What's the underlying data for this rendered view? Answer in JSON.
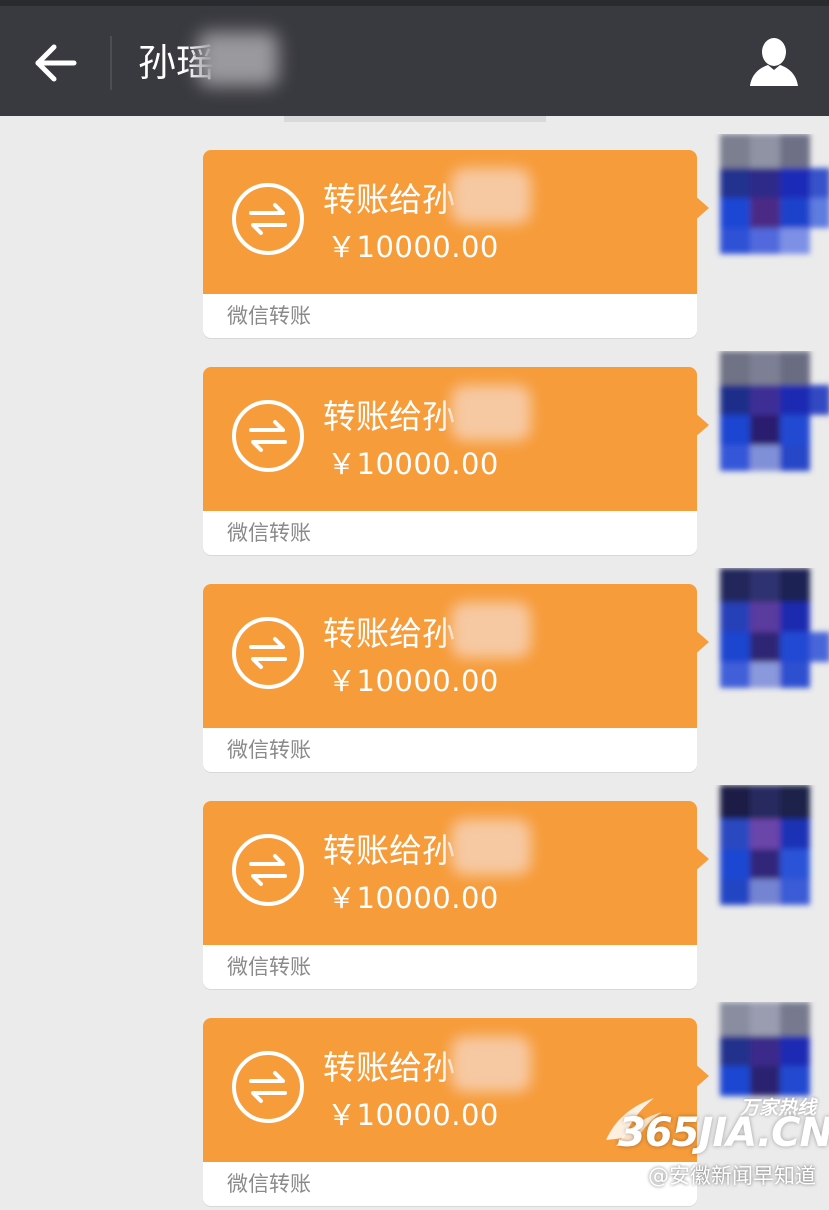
{
  "header": {
    "title": "孙瑶",
    "back_icon": "arrow-left-icon",
    "profile_icon": "person-icon",
    "background": "#393a3f"
  },
  "colors": {
    "card_orange": "#f79c3a",
    "page_bg": "#ebebeb",
    "footer_text": "#8a8a8a"
  },
  "messages": [
    {
      "title": "转账给孙",
      "amount": "￥10000.00",
      "footer": "微信转账",
      "icon": "transfer-icon"
    },
    {
      "title": "转账给孙",
      "amount": "￥10000.00",
      "footer": "微信转账",
      "icon": "transfer-icon"
    },
    {
      "title": "转账给孙",
      "amount": "￥10000.00",
      "footer": "微信转账",
      "icon": "transfer-icon"
    },
    {
      "title": "转账给孙",
      "amount": "￥10000.00",
      "footer": "微信转账",
      "icon": "transfer-icon"
    },
    {
      "title": "转账给孙",
      "amount": "￥10000.00",
      "footer": "微信转账",
      "icon": "transfer-icon"
    }
  ],
  "watermark": {
    "brand": "万家热线",
    "site": "365JIA.CN",
    "weibo": "@安徽新闻早知道"
  }
}
